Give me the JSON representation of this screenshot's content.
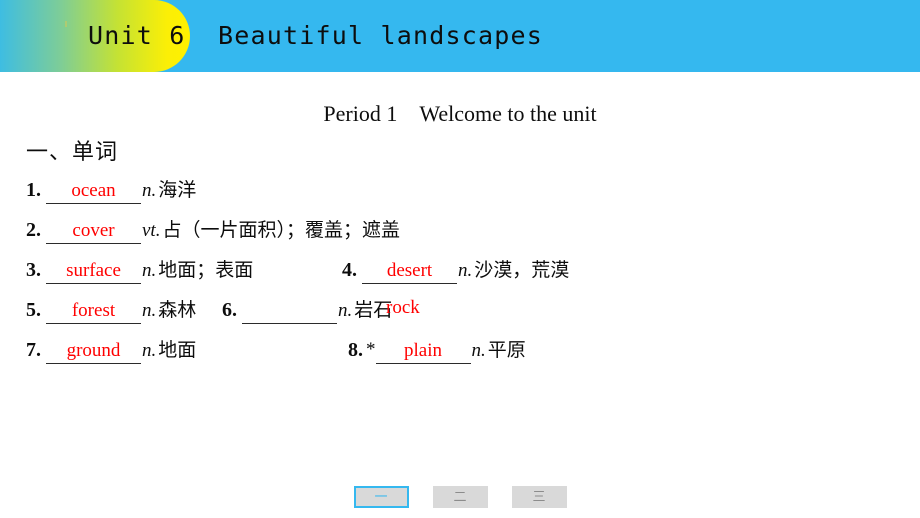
{
  "header": {
    "unit_label": "Unit 6",
    "unit_title": "Beautiful landscapes",
    "full_title": "Unit 6  Beautiful landscapes",
    "background_color": "#35b8ef",
    "accent_color": "#fff000"
  },
  "period": {
    "title": "Period 1　Welcome to the unit"
  },
  "section": {
    "heading": "一、单词"
  },
  "words": [
    {
      "num": "1.",
      "star": "",
      "answer": "ocean",
      "pos": "n.",
      "meaning": "海洋"
    },
    {
      "num": "2.",
      "star": "",
      "answer": "cover",
      "pos": "vt.",
      "meaning": "占（一片面积）；覆盖；遮盖"
    },
    {
      "num": "3.",
      "star": "",
      "answer": "surface",
      "pos": "n.",
      "meaning": "地面；表面"
    },
    {
      "num": "4.",
      "star": "",
      "answer": "desert",
      "pos": "n.",
      "meaning": "沙漠，荒漠"
    },
    {
      "num": "5.",
      "star": "",
      "answer": "forest",
      "pos": "n.",
      "meaning": "森林"
    },
    {
      "num": "6.",
      "star": "",
      "answer": "",
      "pos": "n.",
      "meaning": "岩石",
      "floating_answer": "rock"
    },
    {
      "num": "7.",
      "star": "",
      "answer": "ground",
      "pos": "n.",
      "meaning": "地面"
    },
    {
      "num": "8.",
      "star": "*",
      "answer": "plain",
      "pos": "n.",
      "meaning": "平原"
    }
  ],
  "pager": {
    "buttons": [
      {
        "label": "一",
        "active": true
      },
      {
        "label": "二",
        "active": false
      },
      {
        "label": "三",
        "active": false
      }
    ],
    "active_color": "#35b8ef",
    "inactive_color": "#8c8c8c"
  }
}
